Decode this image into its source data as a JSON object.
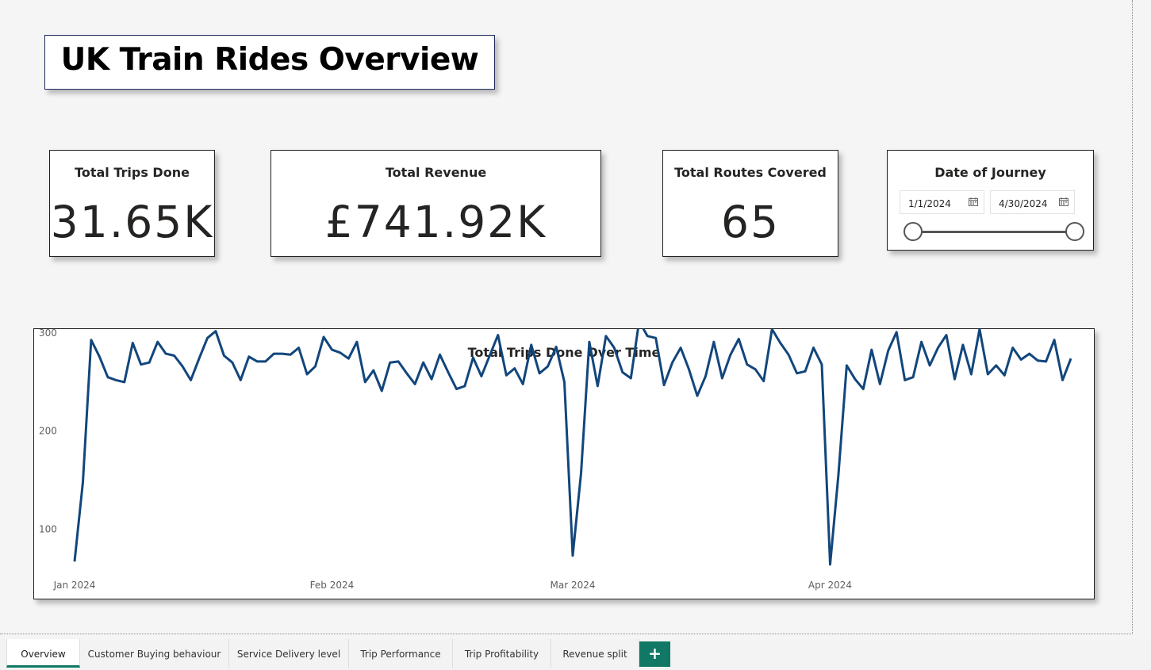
{
  "report": {
    "title": "UK Train Rides Overview"
  },
  "kpis": {
    "trips": {
      "label": "Total Trips Done",
      "value": "31.65K"
    },
    "revenue": {
      "label": "Total Revenue",
      "value": "£741.92K"
    },
    "routes": {
      "label": "Total Routes Covered",
      "value": "65"
    }
  },
  "date_slicer": {
    "label": "Date of Journey",
    "start": "1/1/2024",
    "end": "4/30/2024",
    "icon": "calendar-icon"
  },
  "chart_data": {
    "type": "line",
    "title": "Total Trips Done Over Time",
    "xlabel": "",
    "ylabel": "",
    "x_start": "2024-01-01",
    "x_end": "2024-04-30",
    "x_ticks": [
      "Jan 2024",
      "Feb 2024",
      "Mar 2024",
      "Apr 2024"
    ],
    "y_ticks": [
      100,
      200,
      300
    ],
    "ylim": [
      55,
      330
    ],
    "grid": false,
    "line_color": "#12467c",
    "series": [
      {
        "values": [
          67,
          148,
          293,
          276,
          255,
          252,
          250,
          290,
          268,
          270,
          291,
          279,
          277,
          266,
          252,
          274,
          295,
          302,
          277,
          270,
          252,
          276,
          271,
          271,
          279,
          279,
          278,
          285,
          258,
          266,
          296,
          283,
          280,
          274,
          291,
          250,
          262,
          241,
          270,
          271,
          259,
          248,
          270,
          253,
          278,
          260,
          243,
          246,
          275,
          256,
          277,
          298,
          257,
          264,
          248,
          288,
          259,
          266,
          286,
          250,
          73,
          157,
          291,
          246,
          297,
          285,
          260,
          254,
          312,
          297,
          295,
          247,
          270,
          285,
          263,
          236,
          256,
          291,
          254,
          278,
          294,
          268,
          263,
          251,
          304,
          290,
          278,
          259,
          261,
          285,
          268,
          64,
          155,
          267,
          253,
          243,
          283,
          248,
          282,
          301,
          252,
          255,
          291,
          267,
          285,
          298,
          253,
          288,
          258,
          304,
          258,
          267,
          257,
          285,
          273,
          279,
          272,
          271,
          293,
          252,
          274
        ]
      }
    ]
  },
  "tabs": [
    {
      "label": "Overview",
      "active": true
    },
    {
      "label": "Customer Buying behaviour",
      "active": false
    },
    {
      "label": "Service Delivery level",
      "active": false
    },
    {
      "label": "Trip Performance",
      "active": false
    },
    {
      "label": "Trip Profitability",
      "active": false
    },
    {
      "label": "Revenue split",
      "active": false
    }
  ],
  "add_page": {
    "symbol": "+"
  }
}
